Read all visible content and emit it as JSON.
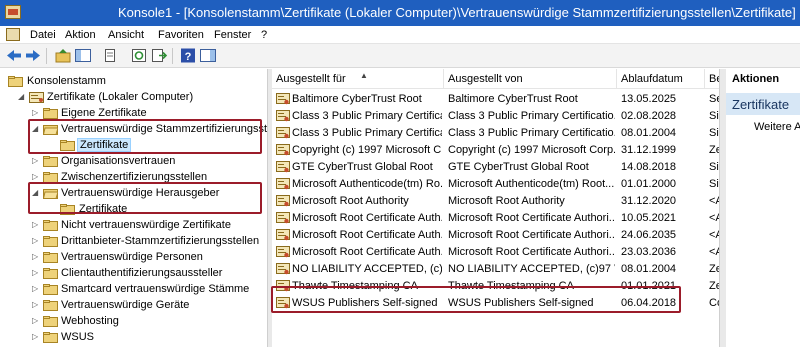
{
  "window": {
    "title": "Konsole1 - [Konsolenstamm\\Zertifikate (Lokaler Computer)\\Vertrauenswürdige Stammzertifizierungsstellen\\Zertifikate]"
  },
  "menu": {
    "items": [
      "Datei",
      "Aktion",
      "Ansicht",
      "Favoriten",
      "Fenster",
      "?"
    ]
  },
  "toolbar": {
    "buttons": [
      "back-icon",
      "forward-icon",
      "up-folder-icon",
      "show-hide-tree-icon",
      "copy-icon",
      "refresh-icon",
      "export-icon",
      "help-icon",
      "action-pane-icon"
    ]
  },
  "tree": {
    "root": "Konsolenstamm",
    "computer": "Zertifikate (Lokaler Computer)",
    "items": [
      {
        "label": "Eigene Zertifikate"
      },
      {
        "label": "Vertrauenswürdige Stammzertifizierungsstellen",
        "expanded": true
      },
      {
        "label": "Zertifikate",
        "selected": true
      },
      {
        "label": "Organisationsvertrauen"
      },
      {
        "label": "Zwischenzertifizierungsstellen"
      },
      {
        "label": "Vertrauenswürdige Herausgeber",
        "expanded": true
      },
      {
        "label": "Zertifikate"
      },
      {
        "label": "Nicht vertrauenswürdige Zertifikate"
      },
      {
        "label": "Drittanbieter-Stammzertifizierungsstellen"
      },
      {
        "label": "Vertrauenswürdige Personen"
      },
      {
        "label": "Clientauthentifizierungsaussteller"
      },
      {
        "label": "Smartcard vertrauenswürdige Stämme"
      },
      {
        "label": "Vertrauenswürdige Geräte"
      },
      {
        "label": "Webhosting"
      },
      {
        "label": "WSUS"
      }
    ]
  },
  "table": {
    "columns": [
      "Ausgestellt für",
      "Ausgestellt von",
      "Ablaufdatum",
      "Be"
    ],
    "rows": [
      [
        "Baltimore CyberTrust Root",
        "Baltimore CyberTrust Root",
        "13.05.2025",
        "Se"
      ],
      [
        "Class 3 Public Primary Certificat...",
        "Class 3 Public Primary Certificatio...",
        "02.08.2028",
        "Sic"
      ],
      [
        "Class 3 Public Primary Certificat...",
        "Class 3 Public Primary Certificatio...",
        "08.01.2004",
        "Sic"
      ],
      [
        "Copyright (c) 1997 Microsoft C...",
        "Copyright (c) 1997 Microsoft Corp.",
        "31.12.1999",
        "Ze"
      ],
      [
        "GTE CyberTrust Global Root",
        "GTE CyberTrust Global Root",
        "14.08.2018",
        "Sic"
      ],
      [
        "Microsoft Authenticode(tm) Ro...",
        "Microsoft Authenticode(tm) Root...",
        "01.01.2000",
        "Sic"
      ],
      [
        "Microsoft Root Authority",
        "Microsoft Root Authority",
        "31.12.2020",
        "<A"
      ],
      [
        "Microsoft Root Certificate Auth...",
        "Microsoft Root Certificate Authori...",
        "10.05.2021",
        "<A"
      ],
      [
        "Microsoft Root Certificate Auth...",
        "Microsoft Root Certificate Authori...",
        "24.06.2035",
        "<A"
      ],
      [
        "Microsoft Root Certificate Auth...",
        "Microsoft Root Certificate Authori...",
        "23.03.2036",
        "<A"
      ],
      [
        "NO LIABILITY ACCEPTED, (c)97 ...",
        "NO LIABILITY ACCEPTED, (c)97 V...",
        "08.01.2004",
        "Ze"
      ],
      [
        "Thawte Timestamping CA",
        "Thawte Timestamping CA",
        "01.01.2021",
        "Ze"
      ],
      [
        "WSUS Publishers Self-signed",
        "WSUS Publishers Self-signed",
        "06.04.2018",
        "Co"
      ]
    ]
  },
  "actions": {
    "header": "Aktionen",
    "section": "Zertifikate",
    "items": [
      "Weitere Ak"
    ]
  },
  "colors": {
    "titlebar": "#1f5fbf",
    "highlight_box": "#9b1c2a",
    "selection": "#cce8ff",
    "actions_section": "#d7e7f6"
  }
}
